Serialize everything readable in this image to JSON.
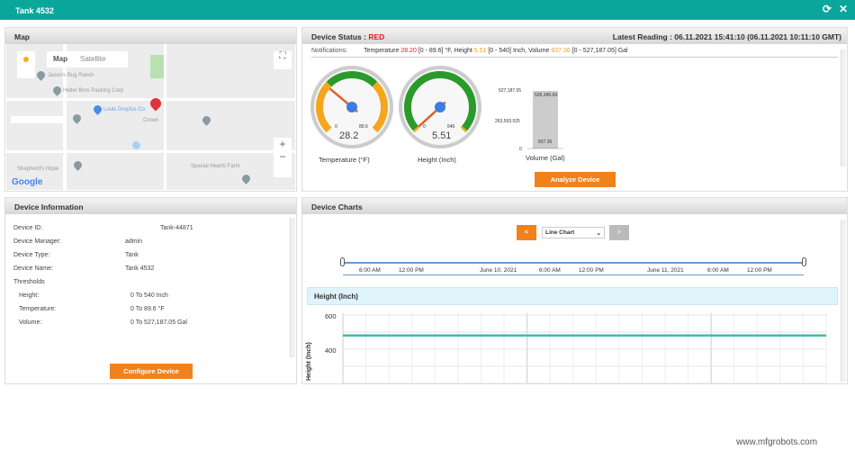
{
  "window": {
    "title": "Tank 4532",
    "refresh_icon": "refresh-icon",
    "close_icon": "close-icon"
  },
  "map": {
    "title": "Map",
    "tab_map": "Map",
    "tab_satellite": "Satellite",
    "labels": [
      "Jason's Bug Ranch",
      "Heller Bros Packing Corp",
      "Louis Dreyfus Co",
      "Shepherd's Hope",
      "Special Hearts Farm",
      "Crown"
    ],
    "google": "Google"
  },
  "status": {
    "title": "Device Status : ",
    "status": "RED",
    "status_color": "#e01e1e",
    "latest": "Latest Reading : 06.11.2021 15:41:10 (06.11.2021 10:11:10 GMT)",
    "notif_label": "Notifications:",
    "notif": {
      "t_label": "Temperature ",
      "t_val": "28.20",
      "t_range": " [0 - 89.6] °F,   Height ",
      "h_val": "5.51",
      "h_range": " [0 - 540] Inch,   Volume ",
      "v_val": "837.36",
      "v_range": " [0 - 527,187.05] Gal"
    },
    "gauges": [
      {
        "label": "Temperature (°F)",
        "value": "28.2",
        "min": "0",
        "max": "89.6",
        "fraction": 0.315
      },
      {
        "label": "Height (Inch)",
        "value": "5.51",
        "min": "0",
        "max": "540",
        "fraction": 0.01
      }
    ],
    "volume": {
      "label": "Volume (Gal)",
      "ticks": [
        "527,187.05",
        "263,593.525",
        "0"
      ],
      "top_label": "526,349.69",
      "value_label": "837.36",
      "value": 837.36,
      "max": 527187.05
    },
    "analyze": "Analyze Device"
  },
  "info": {
    "title": "Device Information",
    "rows": [
      {
        "k": "Device ID:",
        "v": "Tank-44871"
      },
      {
        "k": "Device Manager:",
        "v": "admin"
      },
      {
        "k": "Device Type:",
        "v": "Tank"
      },
      {
        "k": "Device Name:",
        "v": "Tank 4532"
      }
    ],
    "thresholds": "Thresholds",
    "th": [
      {
        "k": "Height:",
        "v": "0 To 540 Inch"
      },
      {
        "k": "Temperature:",
        "v": "0 To 89.6 °F"
      },
      {
        "k": "Volume:",
        "v": "0 To 527,187.05 Gal"
      }
    ],
    "configure": "Configure Device"
  },
  "charts": {
    "title": "Device Charts",
    "prev": "<",
    "next": ">",
    "chart_type": "Line Chart",
    "timeline": [
      "6:00 AM",
      "12:00 PM",
      "June 10, 2021",
      "6:00 AM",
      "12:00 PM",
      "June 11, 2021",
      "6:00 AM",
      "12:00 PM"
    ],
    "chart_data": {
      "type": "line",
      "title": "Height (Inch)",
      "ylabel": "Height (Inch)",
      "yticks": [
        "600",
        "400"
      ],
      "ylim": [
        300,
        600
      ],
      "series": [
        {
          "values": [
            540,
            540
          ]
        }
      ],
      "color": "#3cbfae"
    }
  },
  "watermark": "www.mfgrobots.com"
}
